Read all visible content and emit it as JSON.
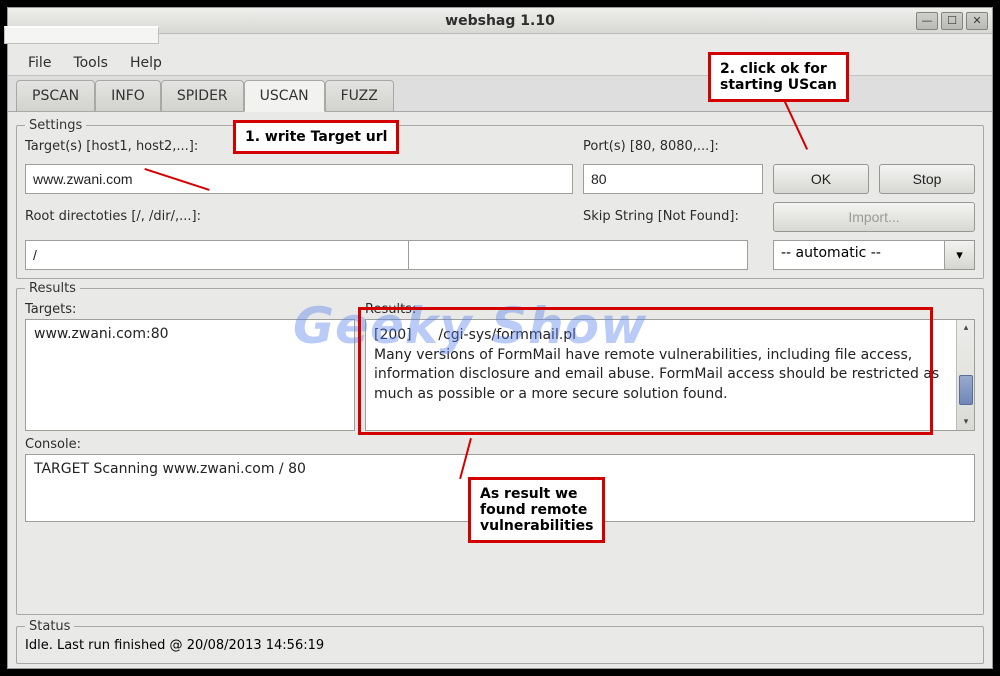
{
  "window": {
    "title": "webshag 1.10"
  },
  "menu": {
    "file": "File",
    "tools": "Tools",
    "help": "Help"
  },
  "tabs": {
    "pscan": "PSCAN",
    "info": "INFO",
    "spider": "SPIDER",
    "uscan": "USCAN",
    "fuzz": "FUZZ"
  },
  "settings": {
    "legend": "Settings",
    "targets_label": "Target(s) [host1, host2,...]:",
    "targets_value": "www.zwani.com",
    "ports_label": "Port(s) [80, 8080,...]:",
    "ports_value": "80",
    "ok_label": "OK",
    "stop_label": "Stop",
    "root_label": "Root directoties [/, /dir/,...]:",
    "root_value": "/",
    "skip_label": "Skip String [Not Found]:",
    "skip_value": "",
    "import_label": "Import...",
    "mode_value": "-- automatic --"
  },
  "results": {
    "legend": "Results",
    "targets_label": "Targets:",
    "targets_item": "www.zwani.com:80",
    "results_label": "Results:",
    "result_code": "[200]",
    "result_path": "/cgi-sys/formmail.pl",
    "result_desc": "Many versions of FormMail have remote vulnerabilities, including file access, information disclosure and email abuse. FormMail access should be restricted as much as possible or a more secure solution found.",
    "console_label": "Console:",
    "console_text": "TARGET  Scanning www.zwani.com / 80"
  },
  "status": {
    "legend": "Status",
    "text": "Idle. Last run finished @ 20/08/2013 14:56:19"
  },
  "annotations": {
    "a1": "1. write Target url",
    "a2": "2. click ok for\nstarting UScan",
    "a3": "As result we\nfound remote\nvulnerabilities"
  },
  "watermark": "Geeky Show"
}
